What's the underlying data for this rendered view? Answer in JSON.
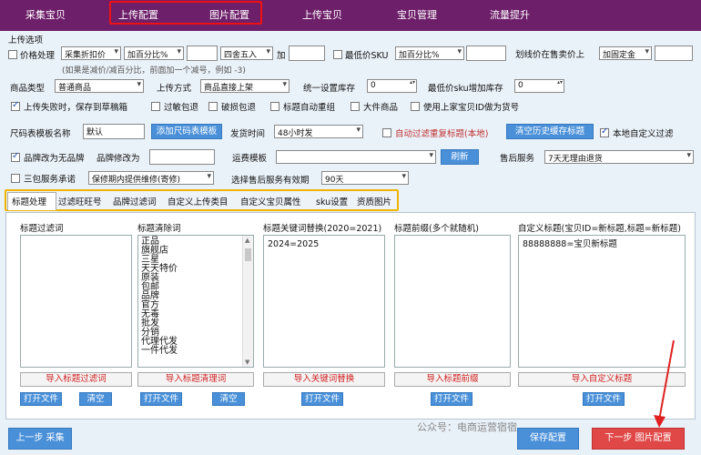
{
  "nav": {
    "tabs": [
      "采集宝贝",
      "上传配置",
      "图片配置",
      "上传宝贝",
      "宝贝管理",
      "流量提升"
    ]
  },
  "section_title": "上传选项",
  "price": {
    "checkbox_label": "价格处理",
    "mode": "采集折扣价",
    "op1": "加百分比%",
    "value1": "",
    "rounding": "四舍五入",
    "add_label": "加",
    "value2": "",
    "min_sku_label": "最低价SKU",
    "op2": "加百分比%",
    "value3": "",
    "strike_label": "划线价在售卖价上",
    "strike_mode": "加固定金",
    "value4": "",
    "hint": "(如果是减价/减百分比，前面加一个减号，例如 -3)"
  },
  "row2": {
    "type_label": "商品类型",
    "type_value": "普通商品",
    "upload_label": "上传方式",
    "upload_value": "商品直接上架",
    "stock_label": "统一设置库存",
    "stock_value": "0",
    "min_stock_label": "最低价sku增加库存",
    "min_stock_value": "0"
  },
  "row3": {
    "items": [
      "上传失败时，保存到草稿箱",
      "过敏包退",
      "破损包退",
      "标题自动重组",
      "大件商品",
      "使用上家宝贝ID做为货号"
    ]
  },
  "row4": {
    "size_label": "尺码表模板名称",
    "size_value": "默认",
    "add_size_btn": "添加尺码表模板",
    "ship_label": "发货时间",
    "ship_value": "48小时发",
    "auto_filter_label": "自动过滤重复标题(本地)",
    "clear_history_btn": "清空历史缓存标题",
    "local_filter_label": "本地自定义过滤"
  },
  "row5": {
    "brand_label": "品牌改为无品牌",
    "brand_change_label": "品牌修改为",
    "brand_value": "",
    "freight_label": "运费模板",
    "freight_value": "",
    "refresh_btn": "刷新",
    "after_sales_label": "售后服务",
    "after_sales_value": "7天无理由退货"
  },
  "row6": {
    "guarantee_label": "三包服务承诺",
    "guarantee_value": "保修期内提供维修(寄修)",
    "period_label": "选择售后服务有效期",
    "period_value": "90天"
  },
  "tabs": [
    "标题处理",
    "过滤旺旺号",
    "品牌过滤词",
    "自定义上传类目",
    "自定义宝贝属性",
    "sku设置",
    "资质图片"
  ],
  "columns": [
    {
      "header": "标题过滤词",
      "content": "",
      "import_btn": "导入标题过滤词",
      "open_btn": "打开文件",
      "clear_btn": "清空"
    },
    {
      "header": "标题清除词",
      "content": "",
      "import_btn": "导入标题清理词",
      "open_btn": "打开文件",
      "clear_btn": "清空"
    },
    {
      "header": "标题关键词替换(2020=2021)",
      "content": "2024=2025",
      "import_btn": "导入关键词替换",
      "open_btn": "打开文件"
    },
    {
      "header": "标题前缀(多个就随机)",
      "content": "",
      "import_btn": "导入标题前缀",
      "open_btn": "打开文件"
    },
    {
      "header": "自定义标题(宝贝ID=新标题,标题=新标题)",
      "content": "88888888=宝贝新标题",
      "import_btn": "导入自定义标题",
      "open_btn": "打开文件"
    }
  ],
  "clean_words": [
    "正品",
    "旗舰店",
    "三星",
    "天天特价",
    "原装",
    "包邮",
    "品牌",
    "官方",
    "无毒",
    "批发",
    "分销",
    "代理代发",
    "一件代发"
  ],
  "bottom": {
    "prev_btn": "上一步 采集",
    "save_btn": "保存配置",
    "next_btn": "下一步 图片配置",
    "watermark": "公众号：电商运营宿宿"
  },
  "colors": {
    "nav_bg": "#6e1f6a",
    "accent": "#4a90d9",
    "highlight_red": "#e11",
    "tab_outline": "#f0b400",
    "import_red": "#d02020"
  }
}
